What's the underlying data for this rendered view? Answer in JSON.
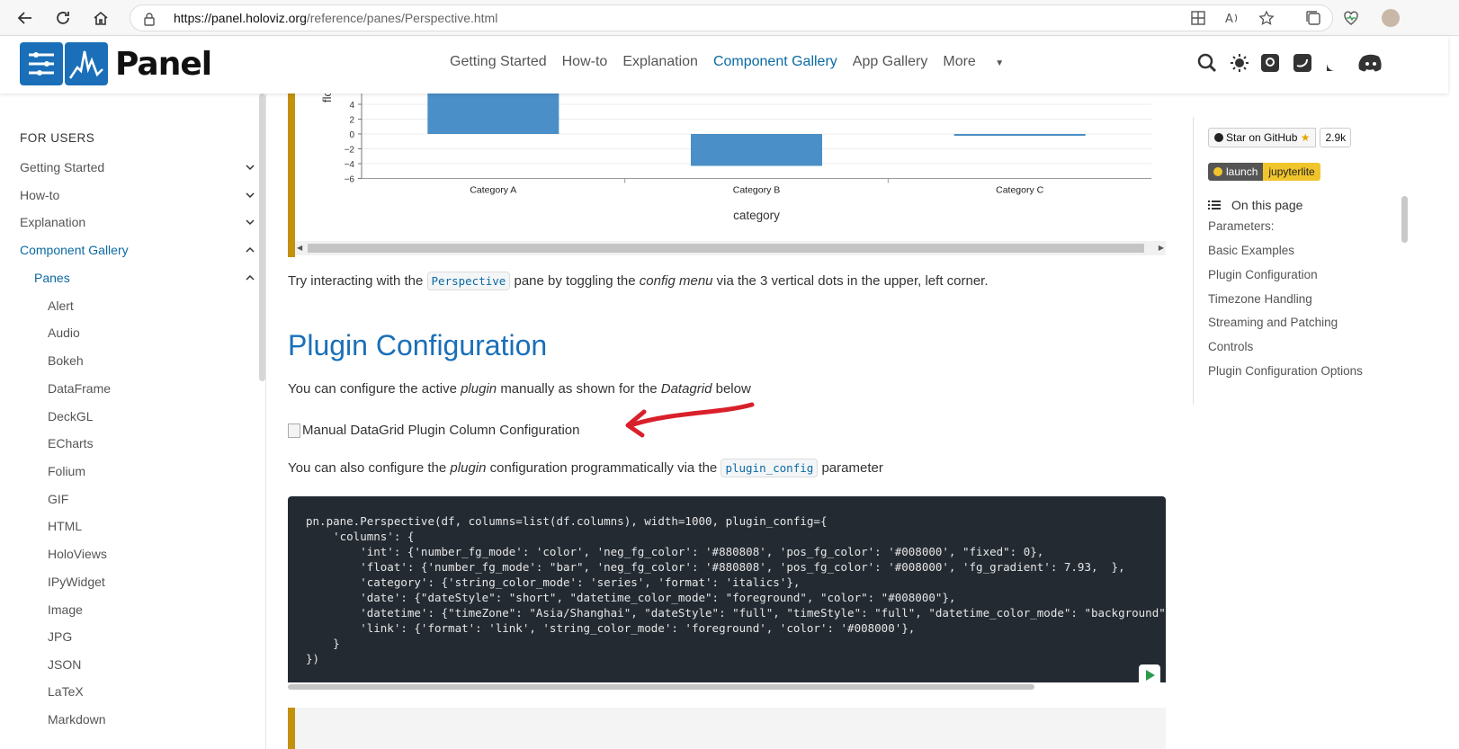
{
  "browser": {
    "url_host": "https://panel.holoviz.org",
    "url_path": "/reference/panes/Perspective.html"
  },
  "header": {
    "logo_text": "Panel",
    "nav": [
      "Getting Started",
      "How-to",
      "Explanation",
      "Component Gallery",
      "App Gallery",
      "More"
    ],
    "active_nav": "Component Gallery"
  },
  "sidebar": {
    "heading": "FOR USERS",
    "items": [
      {
        "label": "Getting Started",
        "level": 0,
        "expand": "down"
      },
      {
        "label": "How-to",
        "level": 0,
        "expand": "down"
      },
      {
        "label": "Explanation",
        "level": 0,
        "expand": "down"
      },
      {
        "label": "Component Gallery",
        "level": 0,
        "expand": "up",
        "active": true
      },
      {
        "label": "Panes",
        "level": 1,
        "expand": "up",
        "active": true
      },
      {
        "label": "Alert",
        "level": 2
      },
      {
        "label": "Audio",
        "level": 2
      },
      {
        "label": "Bokeh",
        "level": 2
      },
      {
        "label": "DataFrame",
        "level": 2
      },
      {
        "label": "DeckGL",
        "level": 2
      },
      {
        "label": "ECharts",
        "level": 2
      },
      {
        "label": "Folium",
        "level": 2
      },
      {
        "label": "GIF",
        "level": 2
      },
      {
        "label": "HTML",
        "level": 2
      },
      {
        "label": "HoloViews",
        "level": 2
      },
      {
        "label": "IPyWidget",
        "level": 2
      },
      {
        "label": "Image",
        "level": 2
      },
      {
        "label": "JPG",
        "level": 2
      },
      {
        "label": "JSON",
        "level": 2
      },
      {
        "label": "LaTeX",
        "level": 2
      },
      {
        "label": "Markdown",
        "level": 2
      }
    ]
  },
  "chart_data": {
    "type": "bar",
    "categories": [
      "Category A",
      "Category B",
      "Category C"
    ],
    "values": [
      6.5,
      -4.3,
      -0.2
    ],
    "xlabel": "category",
    "ylabel": "flo",
    "ylim": [
      -6,
      6
    ],
    "yticks": [
      "4",
      "2",
      "0",
      "−2",
      "−4",
      "−6"
    ],
    "bar_color": "#4a8fc7"
  },
  "content": {
    "para1_a": "Try interacting with the",
    "para1_code": "Perspective",
    "para1_b": "pane by toggling the",
    "para1_em": "config menu",
    "para1_c": "via the 3 vertical dots in the upper, left corner.",
    "heading": "Plugin Configuration",
    "para2_a": "You can configure the active",
    "para2_em1": "plugin",
    "para2_b": "manually as shown for the",
    "para2_em2": "Datagrid",
    "para2_c": "below",
    "image_alt": "Manual DataGrid Plugin Column Configuration",
    "para3_a": "You can also configure the",
    "para3_em": "plugin",
    "para3_b": "configuration programmatically via the",
    "para3_code": "plugin_config",
    "para3_c": "parameter",
    "code_lines": [
      "pn.pane.Perspective(df, columns=list(df.columns), width=1000, plugin_config={",
      "    'columns': {",
      "        'int': {'number_fg_mode': 'color', 'neg_fg_color': '#880808', 'pos_fg_color': '#008000', \"fixed\": 0},",
      "        'float': {'number_fg_mode': \"bar\", 'neg_fg_color': '#880808', 'pos_fg_color': '#008000', 'fg_gradient': 7.93,  },",
      "        'category': {'string_color_mode': 'series', 'format': 'italics'},",
      "        'date': {\"dateStyle\": \"short\", \"datetime_color_mode\": \"foreground\", \"color\": \"#008000\"},",
      "        'datetime': {\"timeZone\": \"Asia/Shanghai\", \"dateStyle\": \"full\", \"timeStyle\": \"full\", \"datetime_color_mode\": \"background\",",
      "        'link': {'format': 'link', 'string_color_mode': 'foreground', 'color': '#008000'},",
      "    }",
      "})"
    ]
  },
  "toc": {
    "github_badge": "Star on GitHub",
    "github_count": "2.9k",
    "jl_left": "launch",
    "jl_right": "jupyterlite",
    "heading": "On this page",
    "items": [
      "Parameters:",
      "Basic Examples",
      "Plugin Configuration",
      "Timezone Handling",
      "Streaming and Patching",
      "Controls",
      "Plugin Configuration Options"
    ]
  },
  "colors": {
    "accent": "#1a6fb8",
    "admonition": "#c2910e",
    "code_bg": "#232a32",
    "annotation_arrow": "#d9202a"
  }
}
